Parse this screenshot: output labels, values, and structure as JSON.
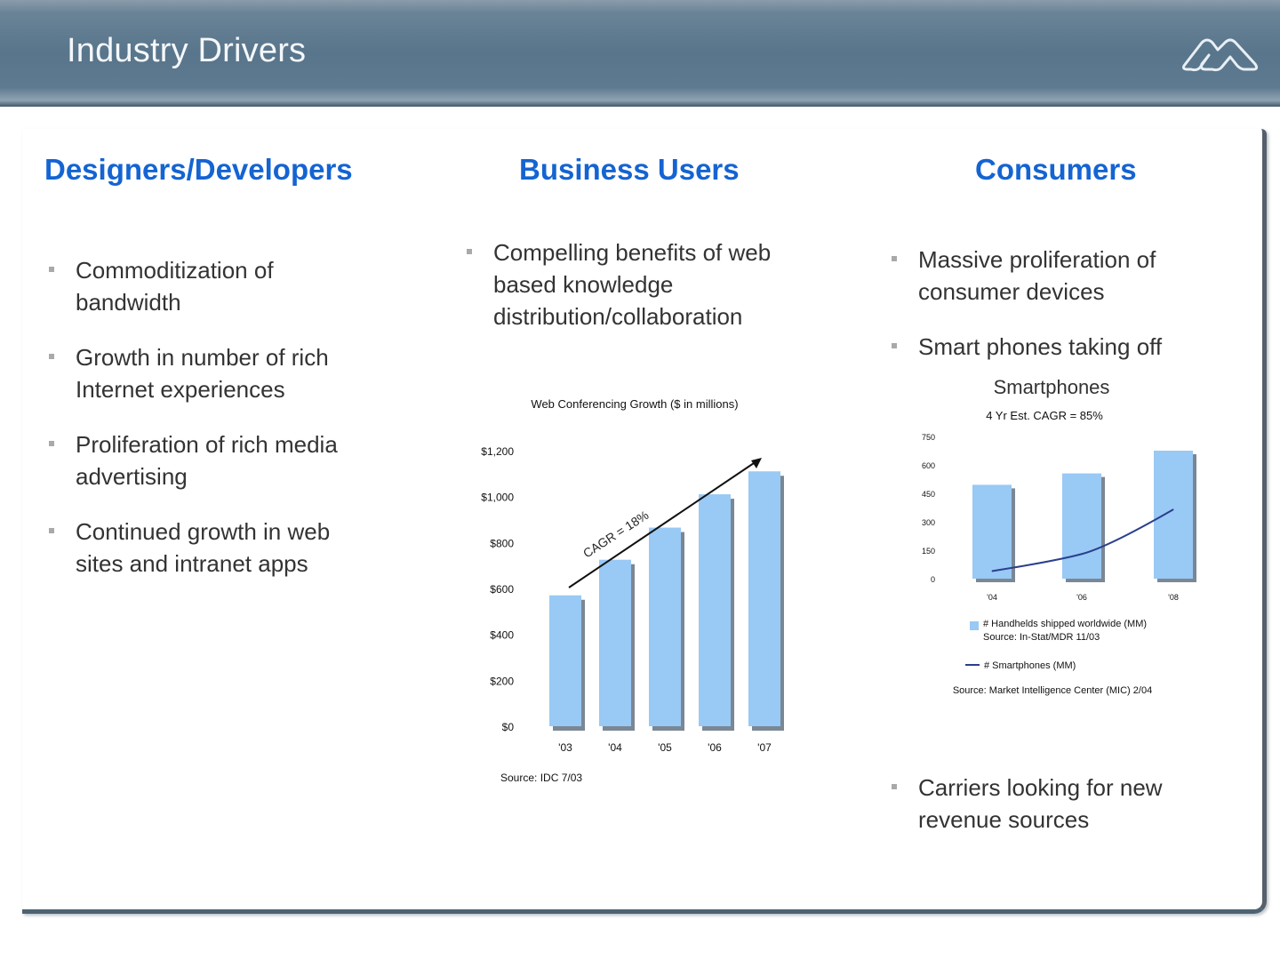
{
  "header": {
    "title": "Industry Drivers",
    "logo_icon": "macromedia-logo-icon"
  },
  "columns": [
    {
      "title": "Designers/Developers",
      "bullets": [
        "Commoditization of bandwidth",
        "Growth in number of rich Internet experiences",
        "Proliferation of rich media advertising",
        "Continued growth in web sites and intranet apps"
      ]
    },
    {
      "title": "Business Users",
      "bullets": [
        "Compelling benefits of web based knowledge distribution/collaboration"
      ]
    },
    {
      "title": "Consumers",
      "bullets": [
        "Massive proliferation of consumer devices",
        "Smart phones taking off",
        "Carriers looking for new revenue sources"
      ]
    }
  ],
  "colors": {
    "title_blue": "#1464d2",
    "bar_fill": "#99c9f5",
    "bar_shadow": "#7a8794",
    "line": "#2b3f8c"
  },
  "chart_data": [
    {
      "type": "bar",
      "title": "Web Conferencing Growth ($ in millions)",
      "categories": [
        "'03",
        "'04",
        "'05",
        "'06",
        "'07"
      ],
      "values": [
        570,
        725,
        865,
        1010,
        1110
      ],
      "yticks": [
        "$0",
        "$200",
        "$400",
        "$600",
        "$800",
        "$1,000",
        "$1,200"
      ],
      "ylim": [
        0,
        1200
      ],
      "xlabel": "",
      "ylabel": "",
      "annotation": "CAGR = 18%",
      "source": "Source: IDC 7/03",
      "grid": false
    },
    {
      "type": "bar",
      "title": "Smartphones",
      "subtitle": "4 Yr Est. CAGR = 85%",
      "categories": [
        "'04",
        "'06",
        "'08"
      ],
      "series": [
        {
          "name": "# Handhelds shipped worldwide (MM)",
          "type": "bar",
          "values": [
            495,
            555,
            675
          ]
        },
        {
          "name": "# Smartphones (MM)",
          "type": "line",
          "values": [
            40,
            130,
            365
          ]
        }
      ],
      "yticks": [
        "0",
        "150",
        "300",
        "450",
        "600",
        "750"
      ],
      "ylim": [
        0,
        750
      ],
      "legend": [
        {
          "label": "# Handhelds shipped worldwide (MM)",
          "source": "Source: In-Stat/MDR 11/03"
        },
        {
          "label": "# Smartphones (MM)"
        }
      ],
      "source": "Source: Market Intelligence Center (MIC) 2/04",
      "legend_position": "bottom",
      "grid": false
    }
  ]
}
